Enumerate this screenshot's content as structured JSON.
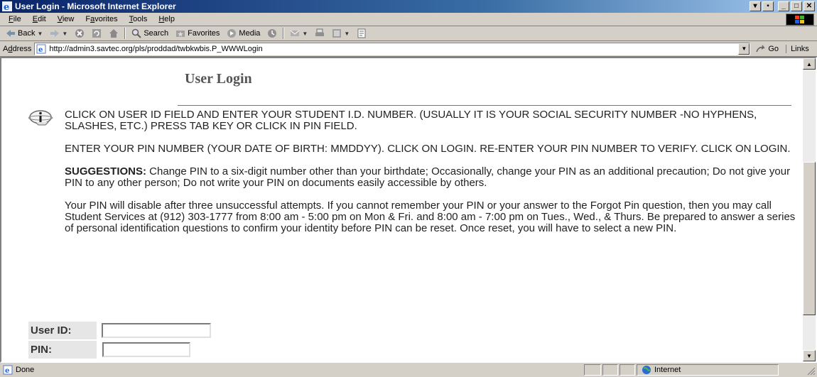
{
  "window": {
    "title": "User Login - Microsoft Internet Explorer"
  },
  "menu": {
    "items": [
      {
        "key": "F",
        "rest": "ile"
      },
      {
        "key": "E",
        "rest": "dit"
      },
      {
        "key": "V",
        "rest": "iew"
      },
      {
        "prefix": "F",
        "key": "a",
        "rest": "vorites"
      },
      {
        "key": "T",
        "rest": "ools"
      },
      {
        "key": "H",
        "rest": "elp"
      }
    ]
  },
  "toolbar": {
    "back_label": "Back",
    "search_label": "Search",
    "favorites_label": "Favorites",
    "media_label": "Media"
  },
  "address": {
    "label_prefix": "A",
    "label_key": "d",
    "label_rest": "dress",
    "url": "http://admin3.savtec.org/pls/proddad/twbkwbis.P_WWWLogin",
    "go_label": "Go",
    "links_label": "Links"
  },
  "page": {
    "heading": "User Login",
    "paragraph1": "CLICK ON USER ID FIELD AND ENTER YOUR STUDENT I.D. NUMBER. (USUALLY IT IS YOUR SOCIAL SECURITY NUMBER -NO HYPHENS, SLASHES, ETC.) PRESS TAB KEY OR CLICK IN PIN FIELD.",
    "paragraph2": "ENTER YOUR PIN NUMBER (YOUR DATE OF BIRTH: MMDDYY). CLICK ON LOGIN. RE-ENTER YOUR PIN NUMBER TO VERIFY. CLICK ON LOGIN.",
    "suggestions_label": "SUGGESTIONS:",
    "suggestions_text": " Change PIN to a six-digit number other than your birthdate; Occasionally, change your PIN as an additional precaution; Do not give your PIN to any other person; Do not write your PIN on documents easily accessible by others.",
    "paragraph4": "Your PIN will disable after three unsuccessful attempts. If you cannot remember your PIN or your answer to the Forgot Pin question, then you may call Student Services at (912) 303-1777 from 8:00 am - 5:00 pm on Mon & Fri. and 8:00 am - 7:00 pm on Tues., Wed., & Thurs. Be prepared to answer a series of personal identification questions to confirm your identity before PIN can be reset. Once reset, you will have to select a new PIN."
  },
  "form": {
    "userid_label": "User ID:",
    "userid_value": "",
    "pin_label": "PIN:",
    "pin_value": ""
  },
  "status": {
    "text": "Done",
    "zone": "Internet"
  }
}
